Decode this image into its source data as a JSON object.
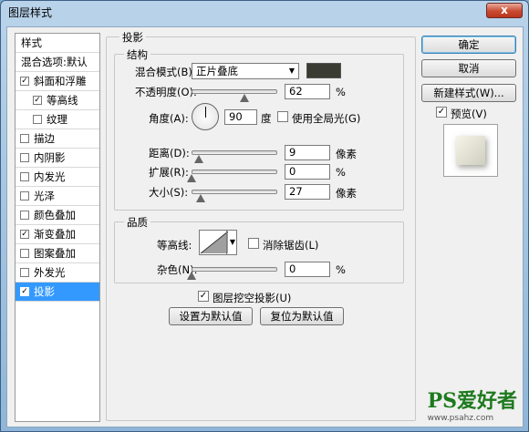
{
  "window": {
    "title": "图层样式",
    "close": "x"
  },
  "left_list": {
    "items": [
      {
        "label": "样式",
        "checkbox": null,
        "selected": false
      },
      {
        "label": "混合选项:默认",
        "checkbox": null,
        "selected": false
      },
      {
        "label": "斜面和浮雕",
        "checked": true,
        "indent": false,
        "selected": false
      },
      {
        "label": "等高线",
        "checked": true,
        "indent": true,
        "selected": false
      },
      {
        "label": "纹理",
        "checked": false,
        "indent": true,
        "selected": false
      },
      {
        "label": "描边",
        "checked": false,
        "indent": false,
        "selected": false
      },
      {
        "label": "内阴影",
        "checked": false,
        "indent": false,
        "selected": false
      },
      {
        "label": "内发光",
        "checked": false,
        "indent": false,
        "selected": false
      },
      {
        "label": "光泽",
        "checked": false,
        "indent": false,
        "selected": false
      },
      {
        "label": "颜色叠加",
        "checked": false,
        "indent": false,
        "selected": false
      },
      {
        "label": "渐变叠加",
        "checked": true,
        "indent": false,
        "selected": false
      },
      {
        "label": "图案叠加",
        "checked": false,
        "indent": false,
        "selected": false
      },
      {
        "label": "外发光",
        "checked": false,
        "indent": false,
        "selected": false
      },
      {
        "label": "投影",
        "checked": true,
        "indent": false,
        "selected": true
      }
    ]
  },
  "drop_shadow": {
    "section_title": "投影",
    "structure": {
      "title": "结构",
      "blend_mode_label": "混合模式(B):",
      "blend_mode_value": "正片叠底",
      "shadow_color": "#3a3b33",
      "opacity_label": "不透明度(O):",
      "opacity_value": "62",
      "opacity_fraction": 0.62,
      "opacity_unit": "%",
      "angle_label": "角度(A):",
      "angle_value": "90",
      "angle_unit": "度",
      "global_light_label": "使用全局光(G)",
      "global_light_checked": false,
      "distance_label": "距离(D):",
      "distance_value": "9",
      "distance_fraction": 0.09,
      "distance_unit": "像素",
      "spread_label": "扩展(R):",
      "spread_value": "0",
      "spread_fraction": 0.0,
      "spread_unit": "%",
      "size_label": "大小(S):",
      "size_value": "27",
      "size_fraction": 0.11,
      "size_unit": "像素"
    },
    "quality": {
      "title": "品质",
      "contour_label": "等高线:",
      "antialias_label": "消除锯齿(L)",
      "antialias_checked": false,
      "noise_label": "杂色(N):",
      "noise_value": "0",
      "noise_fraction": 0.0,
      "noise_unit": "%"
    },
    "knockout_label": "图层挖空投影(U)",
    "knockout_checked": true,
    "make_default": "设置为默认值",
    "reset_default": "复位为默认值"
  },
  "buttons": {
    "ok": "确定",
    "cancel": "取消",
    "new_style": "新建样式(W)...",
    "preview_label": "预览(V)",
    "preview_checked": true
  },
  "watermark": {
    "main": "PS爱好者",
    "sub": "www.psahz.com"
  }
}
